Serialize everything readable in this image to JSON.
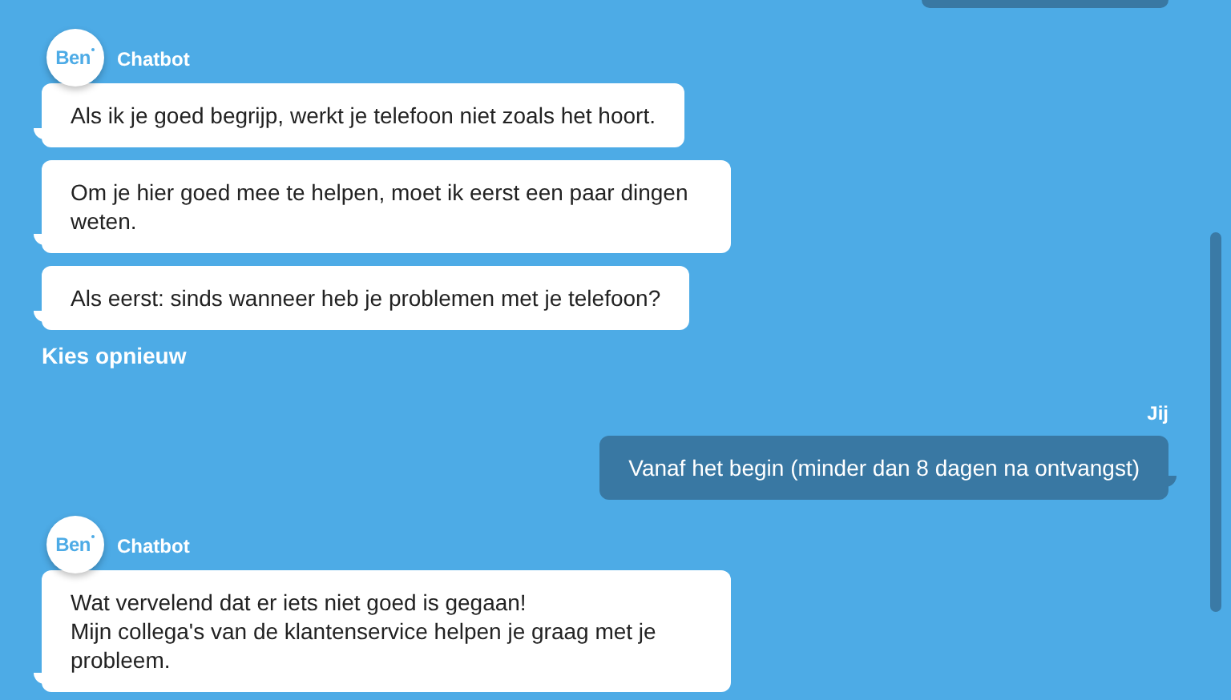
{
  "conversation": [
    {
      "kind": "user_partial"
    },
    {
      "kind": "bot",
      "avatar": "Ben",
      "sender": "Chatbot",
      "messages": [
        "Als ik je goed begrijp, werkt je telefoon niet zoals het hoort.",
        "Om je hier goed mee te helpen, moet ik eerst een paar dingen weten.",
        "Als eerst: sinds wanneer heb je problemen met je telefoon?"
      ],
      "action": "Kies opnieuw"
    },
    {
      "kind": "user",
      "sender": "Jij",
      "messages": [
        "Vanaf het begin (minder dan 8 dagen na ontvangst)"
      ]
    },
    {
      "kind": "bot",
      "avatar": "Ben",
      "sender": "Chatbot",
      "messages": [
        "Wat vervelend dat er iets niet goed is gegaan!\nMijn collega's van de klantenservice helpen je graag met je probleem."
      ]
    }
  ]
}
